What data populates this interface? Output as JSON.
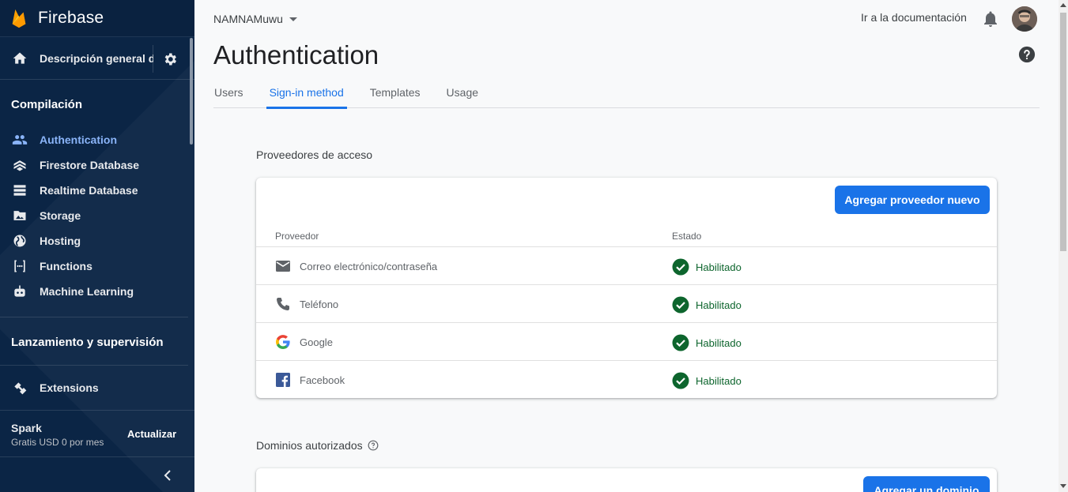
{
  "sidebar": {
    "brand": "Firebase",
    "overview_label": "Descripción general del proyecto",
    "build_section": "Compilación",
    "nav_items": [
      {
        "label": "Authentication",
        "icon": "people-icon",
        "active": true
      },
      {
        "label": "Firestore Database",
        "icon": "firestore-icon",
        "active": false
      },
      {
        "label": "Realtime Database",
        "icon": "database-icon",
        "active": false
      },
      {
        "label": "Storage",
        "icon": "image-icon",
        "active": false
      },
      {
        "label": "Hosting",
        "icon": "globe-icon",
        "active": false
      },
      {
        "label": "Functions",
        "icon": "functions-icon",
        "active": false
      },
      {
        "label": "Machine Learning",
        "icon": "robot-icon",
        "active": false
      }
    ],
    "release_section": "Lanzamiento y supervisión",
    "extensions_label": "Extensions",
    "plan_name": "Spark",
    "plan_price": "Gratis USD 0 por mes",
    "upgrade_label": "Actualizar"
  },
  "header": {
    "project_name": "NAMNAMuwu",
    "docs_link": "Ir a la documentación"
  },
  "page": {
    "title": "Authentication",
    "tabs": [
      {
        "label": "Users",
        "active": false
      },
      {
        "label": "Sign-in method",
        "active": true
      },
      {
        "label": "Templates",
        "active": false
      },
      {
        "label": "Usage",
        "active": false
      }
    ]
  },
  "providers": {
    "section_title": "Proveedores de acceso",
    "add_button": "Agregar proveedor nuevo",
    "col_provider": "Proveedor",
    "col_status": "Estado",
    "rows": [
      {
        "name": "Correo electrónico/contraseña",
        "icon": "mail-icon",
        "status": "Habilitado"
      },
      {
        "name": "Teléfono",
        "icon": "phone-icon",
        "status": "Habilitado"
      },
      {
        "name": "Google",
        "icon": "google-icon",
        "status": "Habilitado"
      },
      {
        "name": "Facebook",
        "icon": "facebook-icon",
        "status": "Habilitado"
      }
    ]
  },
  "domains": {
    "section_title": "Dominios autorizados",
    "add_button": "Agregar un dominio"
  },
  "colors": {
    "sidebar_bg": "#0b2545",
    "accent": "#1a73e8",
    "active_nav": "#8ab4f8",
    "enabled_green": "#0d652d"
  }
}
